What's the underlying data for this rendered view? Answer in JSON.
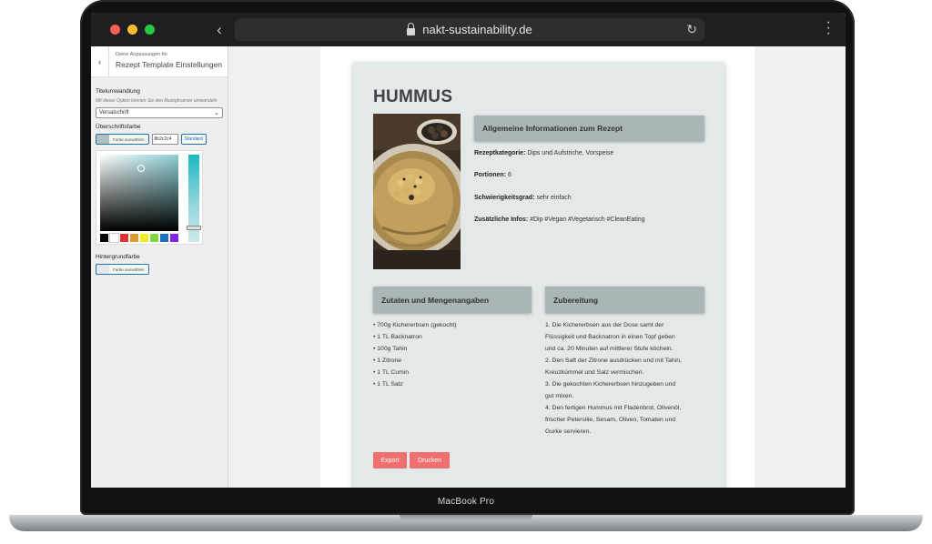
{
  "device": {
    "model_label": "MacBook Pro"
  },
  "browser": {
    "url": "nakt-sustainability.de"
  },
  "sidebar": {
    "subtitle": "Deine Anpassungen für",
    "title": "Rezept Template Einstellungen",
    "title_transform_label": "Titelumwandlung",
    "title_transform_desc": "Mit dieser Option können Sie den Rezeptnamen umwandeln",
    "title_transform_value": "Versalschrift",
    "heading_color_label": "Überschriftsfarbe",
    "choose_color_label": "Farbe auswählen",
    "heading_color_hex": "8b2c2c4",
    "standard_label": "Standard",
    "heading_swatch_color": "#b0bec0",
    "palette": [
      "#000000",
      "#ffffff",
      "#dd3333",
      "#dd9933",
      "#eeee22",
      "#81d742",
      "#1e73be",
      "#8224e3"
    ],
    "background_color_label": "Hintergrundfarbe",
    "background_choose_label": "Farbe auswählen",
    "background_swatch_color": "#e3e8e8"
  },
  "recipe": {
    "title": "HUMMUS",
    "general_heading": "Allgemeine Informationen zum Rezept",
    "category_label": "Rezeptkategorie:",
    "category_value": "Dips und Aufstriche, Vorspeise",
    "portions_label": "Portionen:",
    "portions_value": "6",
    "difficulty_label": "Schwierigkeitsgrad:",
    "difficulty_value": "sehr einfach",
    "extra_label": "Zusätzliche Infos:",
    "extra_value": "#Dip #Vegan #Vegetarisch #CleanEating",
    "ingredients_heading": "Zutaten und Mengenangaben",
    "ingredients": [
      "• 700g Kichererbsen (gekocht)",
      "• 1 TL Backnatron",
      "• 100g Tahin",
      "• 1 Zitrone",
      "• 1 TL Cumin",
      "• 1 TL Salz"
    ],
    "preparation_heading": "Zubereitung",
    "preparation": [
      "1. Die Kichererbsen aus der Dose samt der",
      "Flüssigkeit und Backnatron in einen Topf geben",
      "und ca. 20 Minuten auf mittlerer Stufe köcheln.",
      "2. Den Saft der Zitrone ausdrücken und mit Tahin,",
      "Kreuzkümmel und Salz vermischen.",
      "3. Die gekochten Kichererbsen hinzugeben und",
      "gut mixen.",
      "4. Den fertigen Hummus mit Fladenbrot, Olivenöl,",
      "frischer Petersilie, Sesam, Oliven, Tomaten und",
      "Gurke servieren."
    ],
    "export_label": "Export",
    "print_label": "Drucken",
    "accent_color": "#f06f6f"
  }
}
